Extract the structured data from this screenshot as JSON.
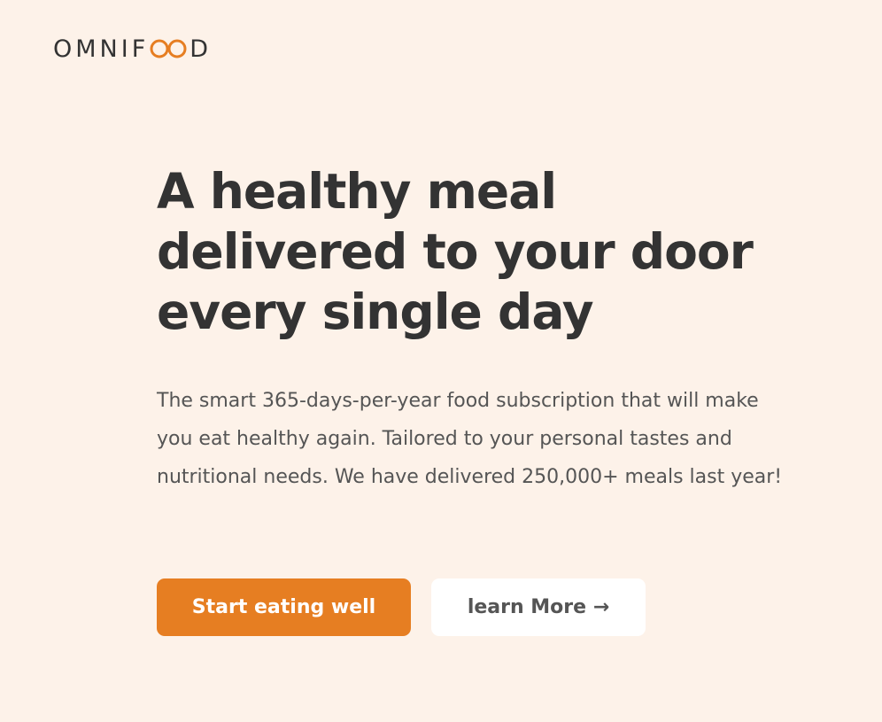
{
  "brand": {
    "name_prefix": "OMNIF",
    "name_suffix": "D",
    "icon": "infinity-icon",
    "accent_color": "#e67e22"
  },
  "hero": {
    "title_lines": [
      "A healthy meal",
      "delivered to your door",
      "every single day"
    ],
    "description": "The smart 365-days-per-year food subscription that will make you eat healthy again. Tailored to your personal tastes and nutritional needs. We have delivered 250,000+ meals last year!",
    "primary_button": "Start eating well",
    "secondary_button": "learn More →"
  },
  "colors": {
    "background": "#fdf2e9",
    "text_primary": "#333333",
    "text_secondary": "#555555",
    "button_primary_bg": "#e67e22",
    "button_secondary_bg": "#ffffff"
  }
}
